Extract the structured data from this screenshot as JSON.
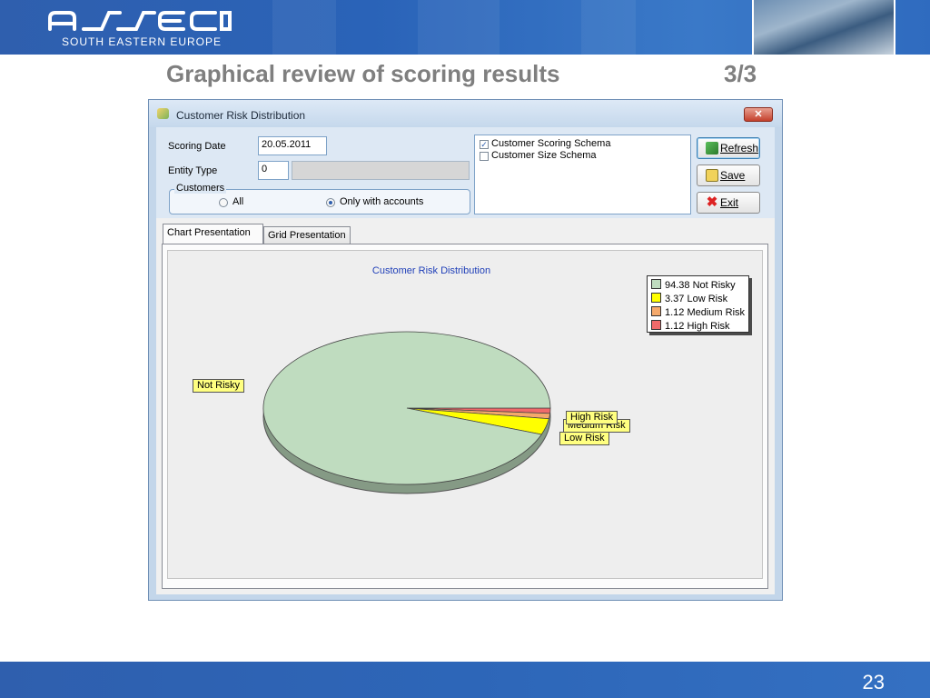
{
  "header": {
    "logo_sub": "SOUTH EASTERN EUROPE",
    "slide_title": "Graphical review of scoring results",
    "slide_part": "3/3"
  },
  "footer": {
    "page_number": "23"
  },
  "window": {
    "title": "Customer Risk Distribution",
    "close_glyph": "✕",
    "filters": {
      "scoring_date_label": "Scoring Date",
      "scoring_date_value": "20.05.2011",
      "entity_type_label": "Entity Type",
      "entity_type_code": "0",
      "entity_type_name": "",
      "customers_group_label": "Customers",
      "radio_all": "All",
      "radio_only_accounts": "Only with accounts",
      "selected_radio": "Only with accounts"
    },
    "schemas": [
      {
        "label": "Customer Scoring Schema",
        "checked": true
      },
      {
        "label": "Customer Size Schema",
        "checked": false
      }
    ],
    "buttons": {
      "refresh": "Refresh",
      "save": "Save",
      "exit": "Exit"
    },
    "tabs": [
      {
        "label": "Chart Presentation",
        "active": true
      },
      {
        "label": "Grid Presentation",
        "active": false
      }
    ]
  },
  "chart_data": {
    "type": "pie",
    "title": "Customer Risk Distribution",
    "categories": [
      "Not Risky",
      "Low Risk",
      "Medium Risk",
      "High Risk"
    ],
    "values": [
      94.38,
      3.37,
      1.12,
      1.12
    ],
    "legend_labels": [
      "94.38 Not Risky",
      "3.37 Low Risk",
      "1.12 Medium Risk",
      "1.12 High Risk"
    ],
    "colors": [
      "#bfdcbf",
      "#ffff00",
      "#f5a96b",
      "#f06a6a"
    ],
    "legend_position": "top-right",
    "style": "3d"
  },
  "colors": {
    "brand_blue": "#2f5fae",
    "title_gray": "#7f7f7f"
  }
}
